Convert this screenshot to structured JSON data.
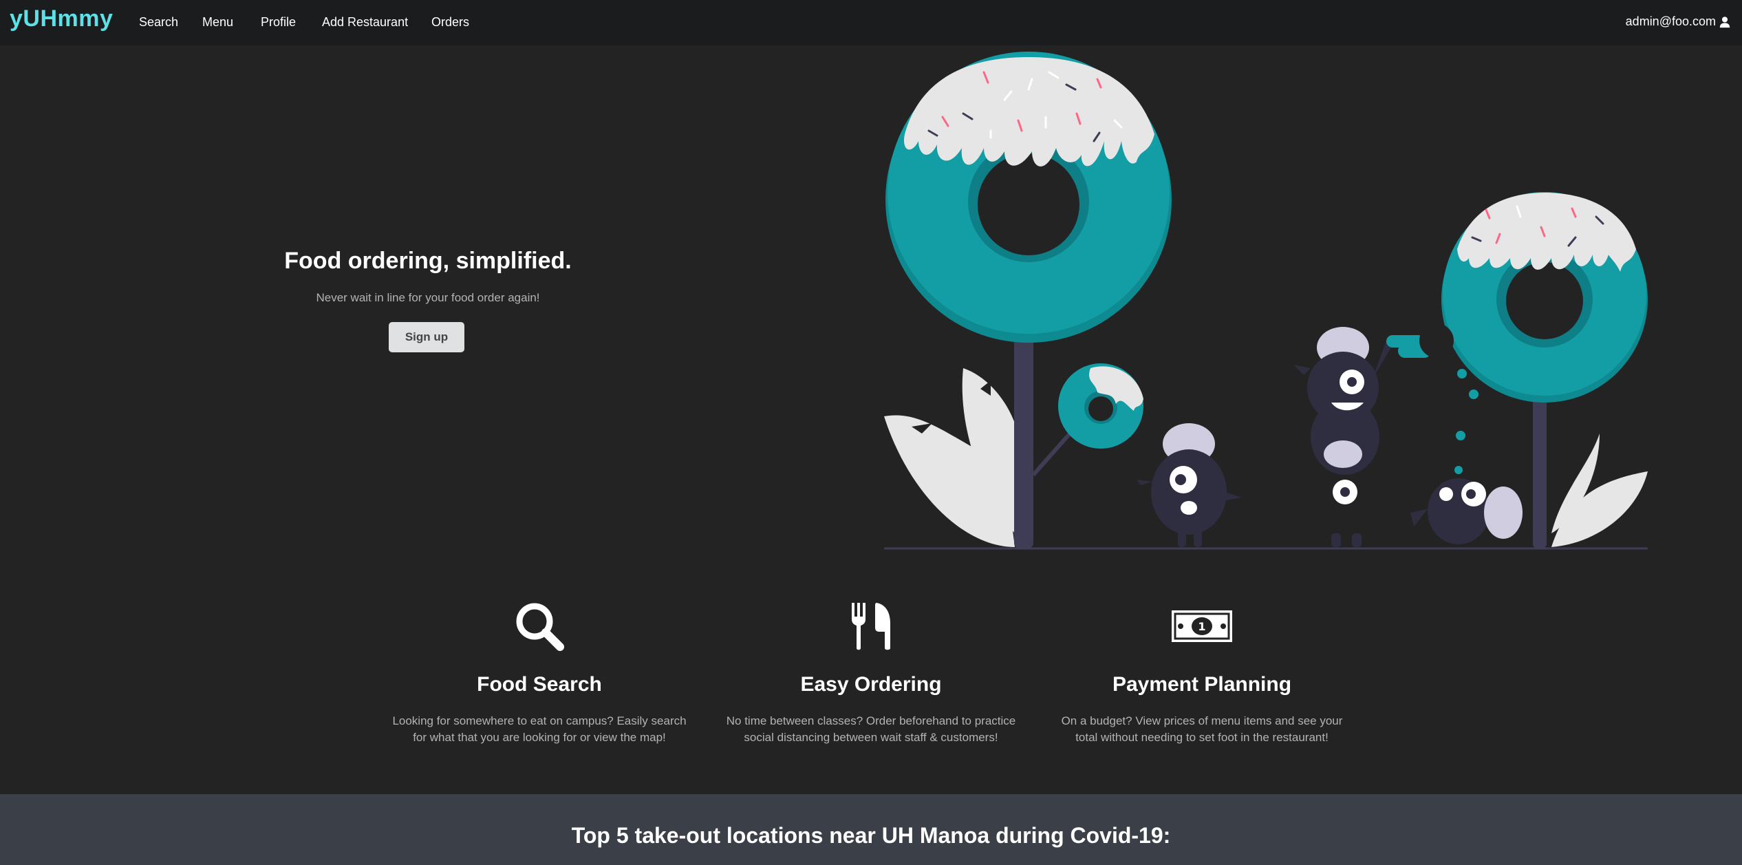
{
  "nav": {
    "brand": "yUHmmy",
    "items": [
      "Search",
      "Menu",
      "Profile",
      "Add Restaurant",
      "Orders"
    ],
    "user_email": "admin@foo.com"
  },
  "hero": {
    "title": "Food ordering, simplified.",
    "subtitle": "Never wait in line for your food order again!",
    "signup_label": "Sign up"
  },
  "features": [
    {
      "icon": "search-icon",
      "title": "Food Search",
      "line1": "Looking for somewhere to eat on campus? Easily search",
      "line2": "for what that you are looking for or view the map!"
    },
    {
      "icon": "utensils-icon",
      "title": "Easy Ordering",
      "line1": "No time between classes? Order beforehand to practice",
      "line2": "social distancing between wait staff & customers!"
    },
    {
      "icon": "money-bill-icon",
      "title": "Payment Planning",
      "line1": "On a budget? View prices of menu items and see your",
      "line2": "total without needing to set foot in the restaurant!"
    }
  ],
  "bottom": {
    "title": "Top 5 take-out locations near UH Manoa during Covid-19:"
  },
  "colors": {
    "brand": "#5de1e6",
    "teal": "#139ea6",
    "background": "#232323",
    "navbar": "#1b1c1d",
    "bottom_bar": "#3a3f48"
  }
}
